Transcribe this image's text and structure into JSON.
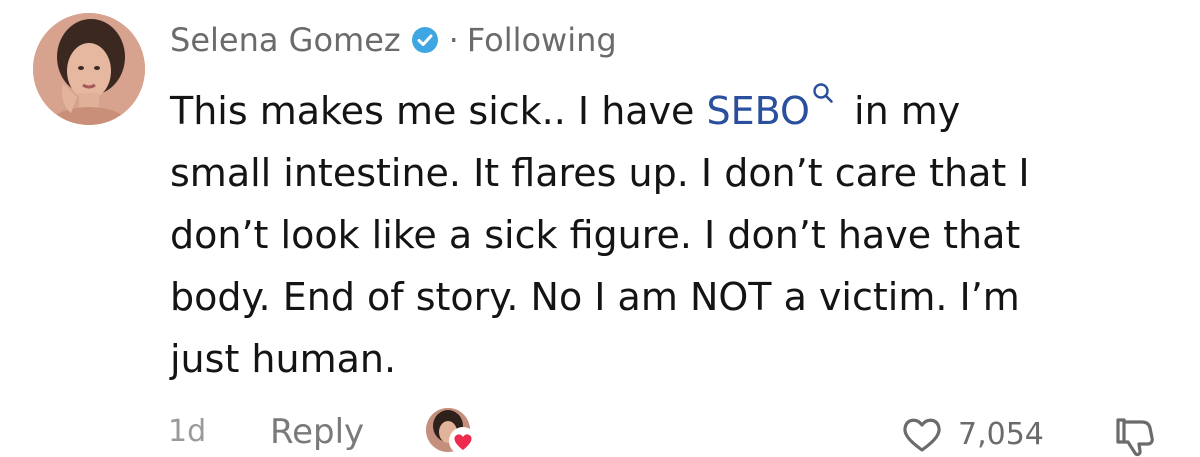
{
  "comment": {
    "author": "Selena Gomez",
    "separator": "·",
    "follow_status": "Following",
    "lines": [
      {
        "before": "This makes me sick.. I have ",
        "link": "SEBO",
        "after": " in my"
      },
      {
        "text": "small intestine. It flares up. I don’t care that I"
      },
      {
        "text": "don’t look like a sick figure. I don’t have that"
      },
      {
        "text": "body. End of story. No I am NOT a victim. I’m"
      },
      {
        "text": "just human."
      }
    ],
    "time": "1d",
    "reply_label": "Reply",
    "like_count": "7,054"
  },
  "icons": {
    "verified": "verified-badge-icon",
    "search": "search-icon",
    "like": "heart-outline-icon",
    "dislike": "thumbs-down-icon",
    "creator_liked": "heart-filled-icon"
  },
  "colors": {
    "link": "#2a4f9c",
    "verified": "#3ea6e0",
    "creator_heart": "#ee2a4f"
  }
}
